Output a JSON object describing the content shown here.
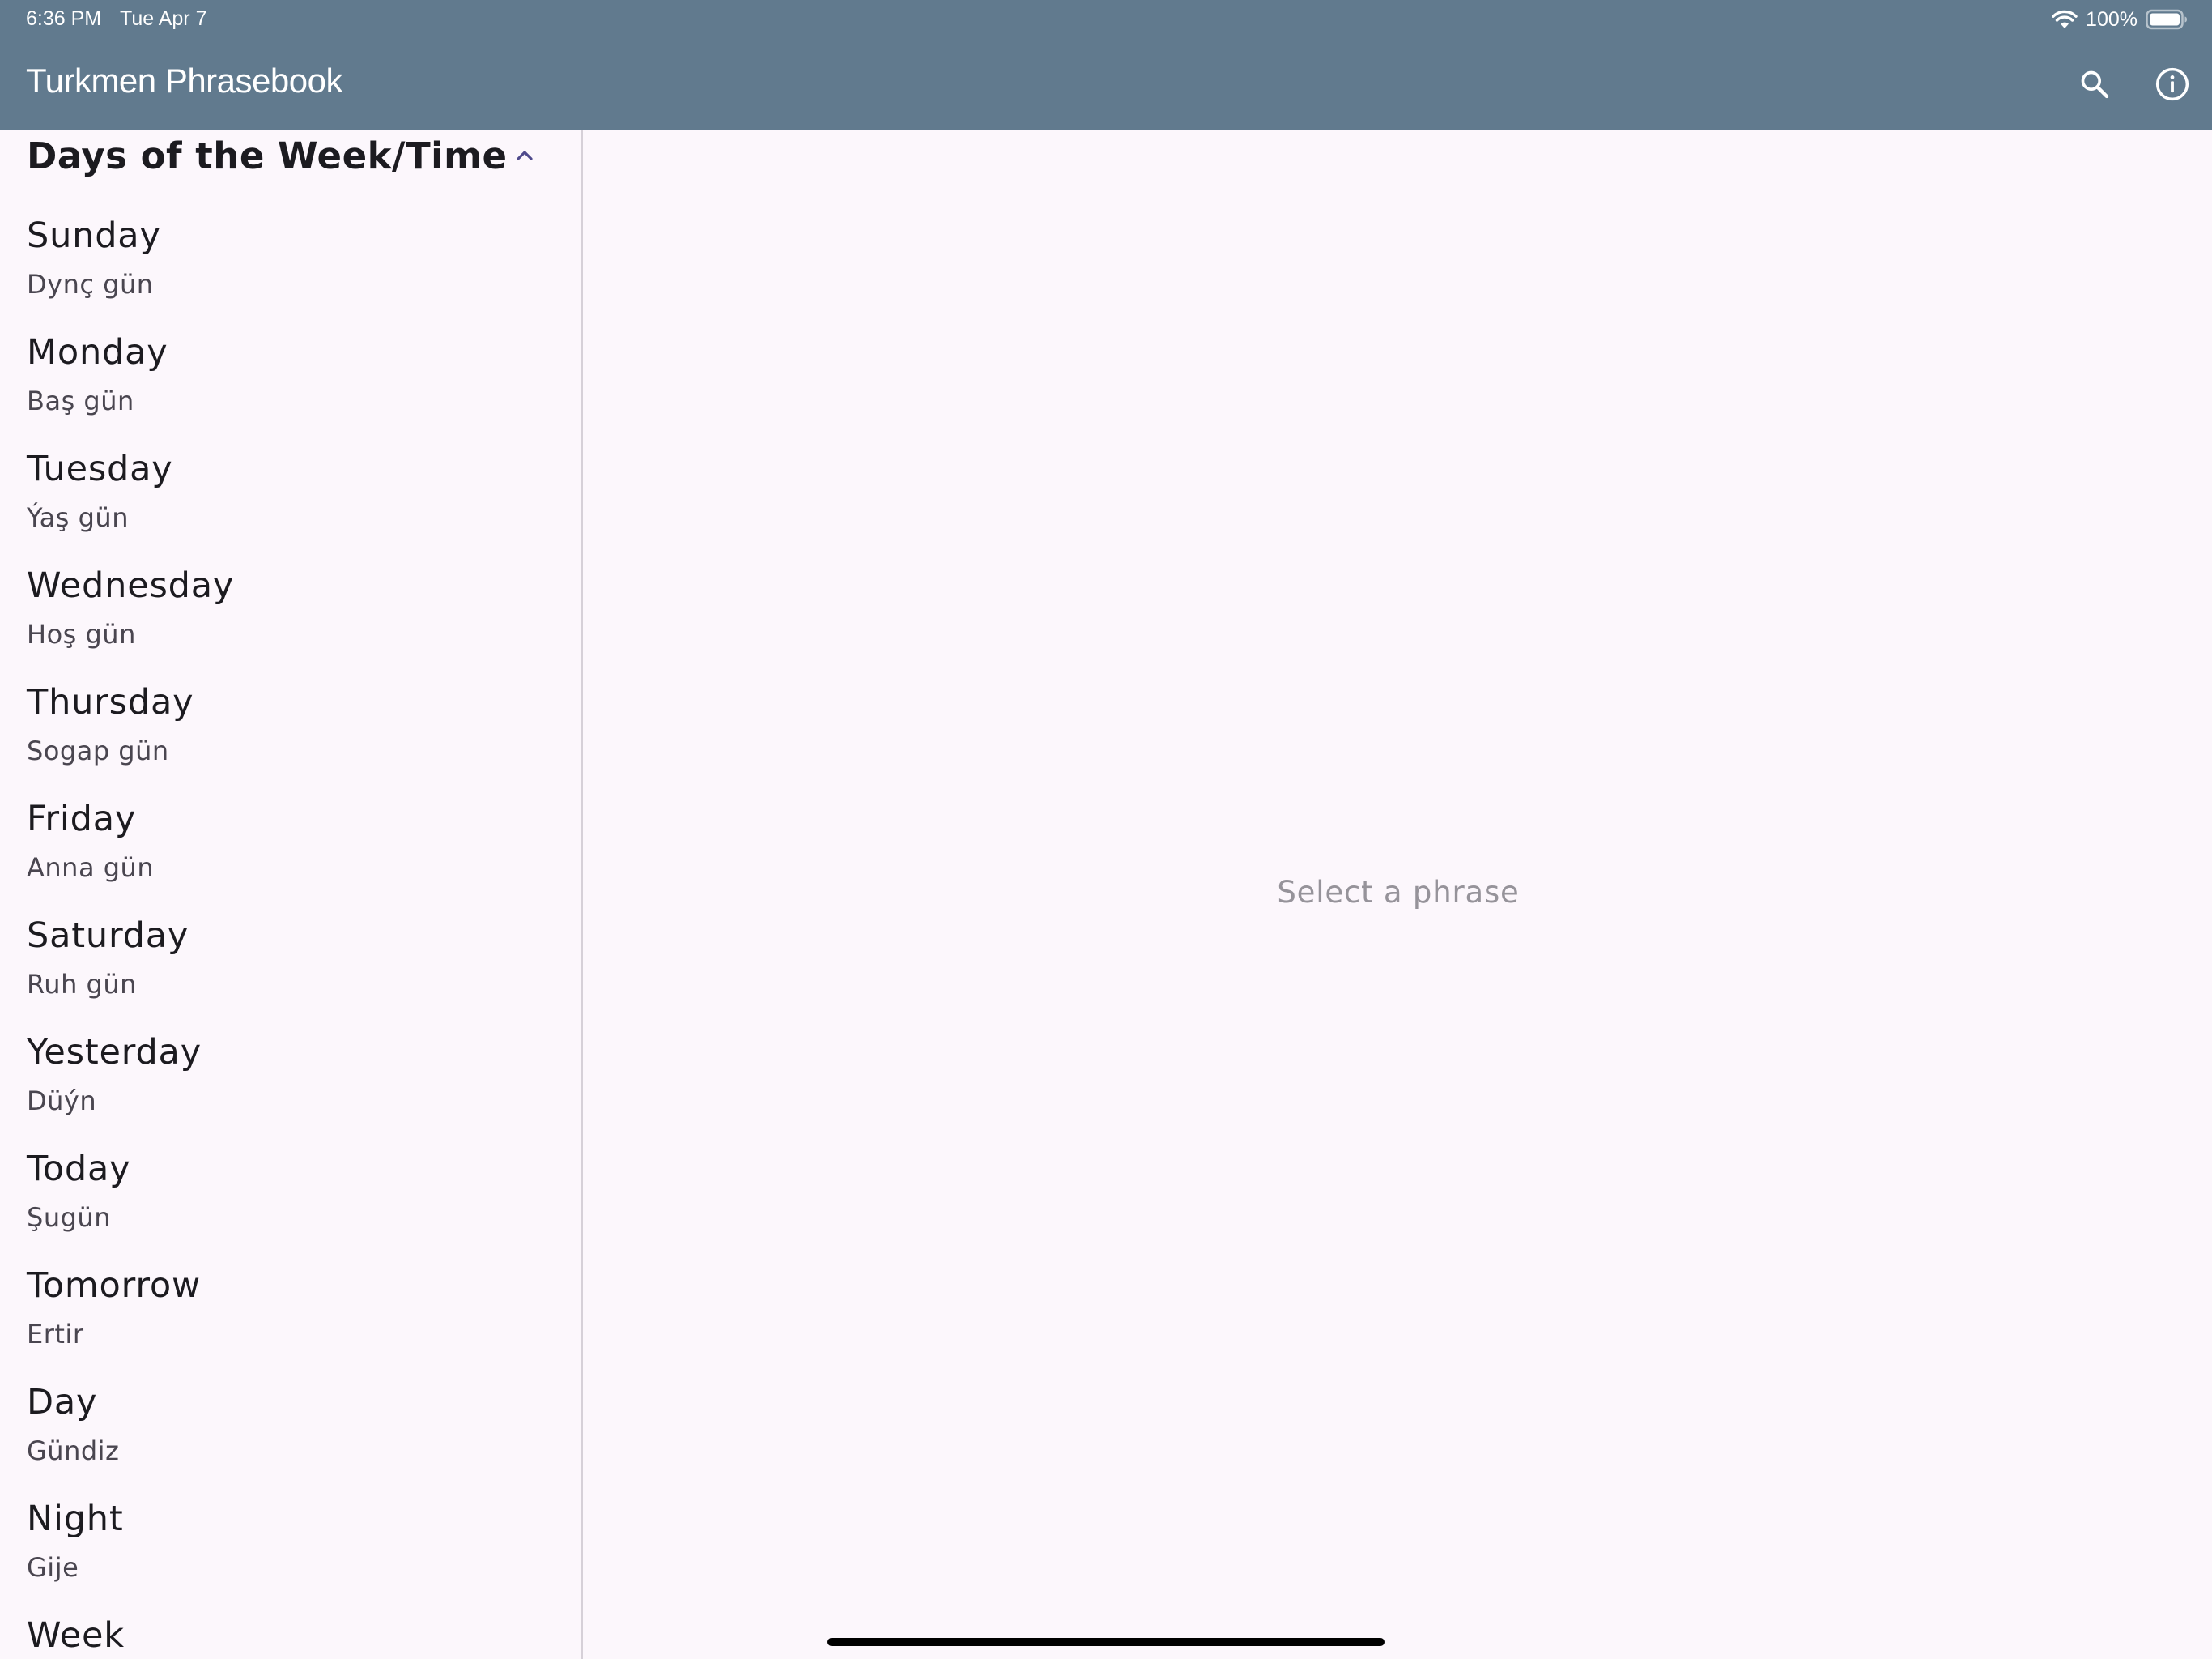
{
  "status_bar": {
    "time": "6:36 PM",
    "date": "Tue Apr 7",
    "battery_percent": "100%",
    "battery_level": 1.0
  },
  "app_bar": {
    "title": "Turkmen Phrasebook",
    "background_color": "#617a8e",
    "search_icon": "search-icon",
    "info_icon": "info-icon"
  },
  "section": {
    "title": "Days of the Week/Time",
    "expanded": true,
    "toggle_icon": "chevron-up-icon"
  },
  "phrases": [
    {
      "english": "Sunday",
      "turkmen": "Dynç gün"
    },
    {
      "english": "Monday",
      "turkmen": "Baş gün"
    },
    {
      "english": "Tuesday",
      "turkmen": "Ýaş gün"
    },
    {
      "english": "Wednesday",
      "turkmen": "Hoş gün"
    },
    {
      "english": "Thursday",
      "turkmen": "Sogap gün"
    },
    {
      "english": "Friday",
      "turkmen": "Anna gün"
    },
    {
      "english": "Saturday",
      "turkmen": "Ruh gün"
    },
    {
      "english": "Yesterday",
      "turkmen": "Düýn"
    },
    {
      "english": "Today",
      "turkmen": "Şugün"
    },
    {
      "english": "Tomorrow",
      "turkmen": "Ertir"
    },
    {
      "english": "Day",
      "turkmen": "Gündiz"
    },
    {
      "english": "Night",
      "turkmen": "Gije"
    },
    {
      "english": "Week",
      "turkmen": ""
    }
  ],
  "detail": {
    "placeholder": "Select a phrase"
  },
  "colors": {
    "background": "#fcf7fc",
    "accent": "#4f4a8c",
    "primary_text": "#1c1b20",
    "secondary_text": "#4a4650",
    "placeholder_text": "#96939a"
  }
}
